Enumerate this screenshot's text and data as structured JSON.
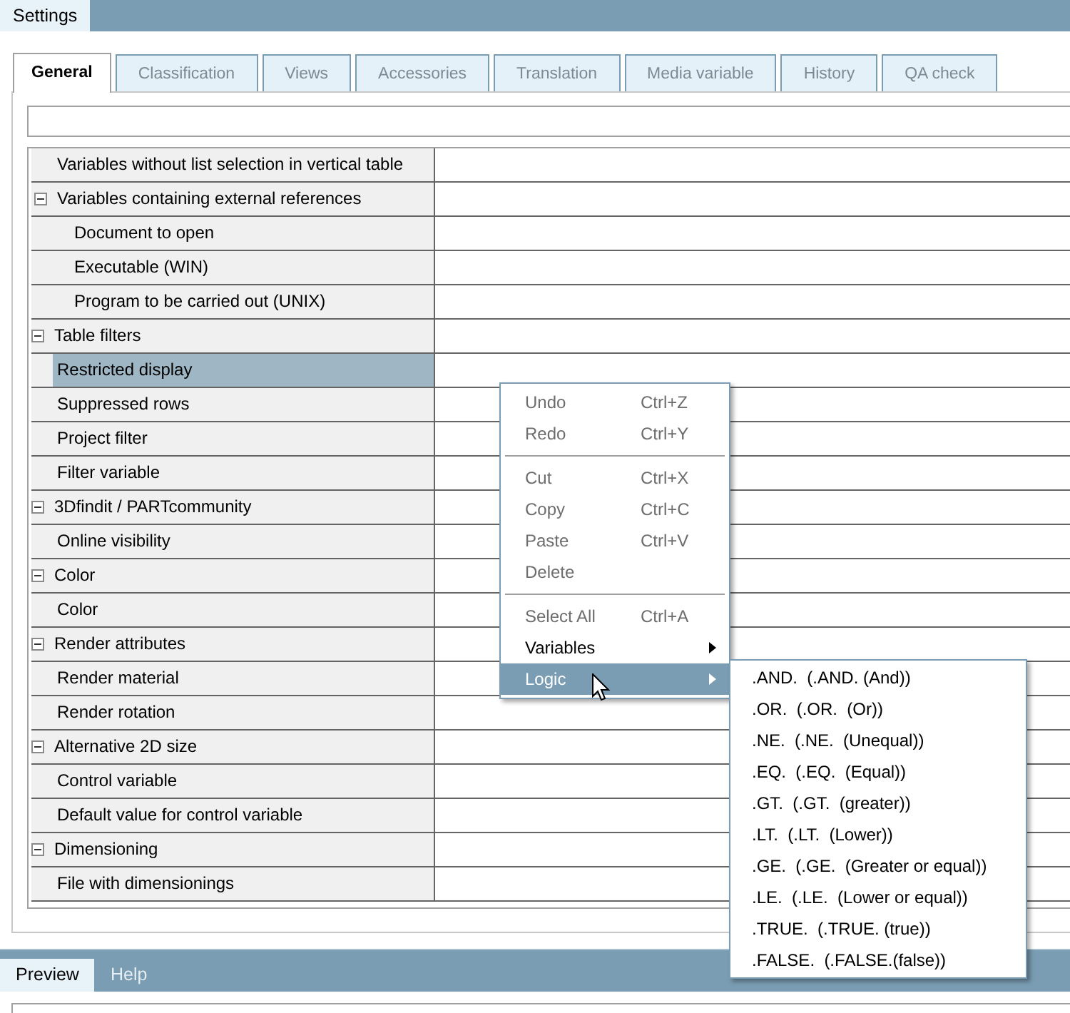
{
  "window": {
    "title": "Settings"
  },
  "tabs": [
    {
      "label": "General",
      "selected": true
    },
    {
      "label": "Classification",
      "selected": false
    },
    {
      "label": "Views",
      "selected": false
    },
    {
      "label": "Accessories",
      "selected": false
    },
    {
      "label": "Translation",
      "selected": false
    },
    {
      "label": "Media variable",
      "selected": false
    },
    {
      "label": "History",
      "selected": false
    },
    {
      "label": "QA check",
      "selected": false
    }
  ],
  "property_tree": [
    {
      "children": [
        {
          "label": "Variables without list selection in vertical table",
          "selected": false
        },
        {
          "label": "Variables containing external references",
          "expanded": true,
          "selected": false,
          "children": [
            {
              "label": "Document to open",
              "selected": false
            },
            {
              "label": "Executable (WIN)",
              "selected": false
            },
            {
              "label": "Program to be carried out (UNIX)",
              "selected": false
            }
          ]
        }
      ]
    },
    {
      "label": "Table filters",
      "expanded": true,
      "selected": false,
      "children": [
        {
          "label": "Restricted display",
          "selected": true
        },
        {
          "label": "Suppressed rows",
          "selected": false
        },
        {
          "label": "Project filter",
          "selected": false
        },
        {
          "label": "Filter variable",
          "selected": false
        }
      ]
    },
    {
      "label": "3Dfindit / PARTcommunity",
      "expanded": true,
      "selected": false,
      "children": [
        {
          "label": "Online visibility",
          "selected": false
        }
      ]
    },
    {
      "label": "Color",
      "expanded": true,
      "selected": false,
      "children": [
        {
          "label": "Color",
          "selected": false
        }
      ]
    },
    {
      "label": "Render attributes",
      "expanded": true,
      "selected": false,
      "children": [
        {
          "label": "Render material",
          "selected": false
        },
        {
          "label": "Render rotation",
          "selected": false
        }
      ]
    },
    {
      "label": "Alternative 2D size",
      "expanded": true,
      "selected": false,
      "children": [
        {
          "label": "Control variable",
          "selected": false
        },
        {
          "label": "Default value for control variable",
          "selected": false
        }
      ]
    },
    {
      "label": "Dimensioning",
      "expanded": true,
      "selected": false,
      "children": [
        {
          "label": "File with dimensionings",
          "selected": false
        }
      ]
    }
  ],
  "context_menu": {
    "items": [
      {
        "kind": "item",
        "label": "Undo",
        "shortcut": "Ctrl+Z",
        "disabled": true,
        "selected": false
      },
      {
        "kind": "item",
        "label": "Redo",
        "shortcut": "Ctrl+Y",
        "disabled": true,
        "selected": false
      },
      {
        "kind": "separator"
      },
      {
        "kind": "item",
        "label": "Cut",
        "shortcut": "Ctrl+X",
        "disabled": true,
        "selected": false
      },
      {
        "kind": "item",
        "label": "Copy",
        "shortcut": "Ctrl+C",
        "disabled": true,
        "selected": false
      },
      {
        "kind": "item",
        "label": "Paste",
        "shortcut": "Ctrl+V",
        "disabled": true,
        "selected": false
      },
      {
        "kind": "item",
        "label": "Delete",
        "disabled": true,
        "selected": false
      },
      {
        "kind": "separator"
      },
      {
        "kind": "item",
        "label": "Select All",
        "shortcut": "Ctrl+A",
        "disabled": true,
        "selected": false
      },
      {
        "kind": "submenu",
        "label": "Variables",
        "disabled": false,
        "selected": false
      },
      {
        "kind": "submenu",
        "label": "Logic",
        "disabled": false,
        "selected": true
      }
    ]
  },
  "submenu": {
    "items": [
      {
        "label": ".AND.  (.AND. (And))"
      },
      {
        "label": ".OR.  (.OR.  (Or))"
      },
      {
        "label": ".NE.  (.NE.  (Unequal))"
      },
      {
        "label": ".EQ.  (.EQ.  (Equal))"
      },
      {
        "label": ".GT.  (.GT.  (greater))"
      },
      {
        "label": ".LT.  (.LT.  (Lower))"
      },
      {
        "label": ".GE.  (.GE.  (Greater or equal))"
      },
      {
        "label": ".LE.  (.LE.  (Lower or equal))"
      },
      {
        "label": ".TRUE.  (.TRUE. (true))"
      },
      {
        "label": ".FALSE.  (.FALSE.(false))"
      }
    ]
  },
  "bottom_tabs": [
    {
      "label": "Preview",
      "selected": true
    },
    {
      "label": "Help",
      "selected": false
    }
  ]
}
